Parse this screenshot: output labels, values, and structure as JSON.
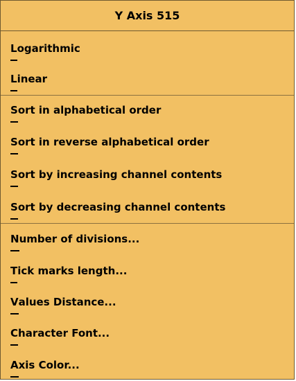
{
  "menu": {
    "title": "Y Axis 515",
    "groups": [
      {
        "items": [
          {
            "label": "Logarithmic",
            "mnemonic": "L",
            "rest": "ogarithmic"
          },
          {
            "label": "Linear",
            "mnemonic": "L",
            "rest": "inear"
          }
        ]
      },
      {
        "items": [
          {
            "label": "Sort in alphabetical order",
            "mnemonic": "S",
            "rest": "ort in alphabetical order"
          },
          {
            "label": "Sort in reverse alphabetical order",
            "mnemonic": "S",
            "rest": "ort in reverse alphabetical order"
          },
          {
            "label": "Sort by increasing channel contents",
            "mnemonic": "S",
            "rest": "ort by increasing channel contents"
          },
          {
            "label": "Sort by decreasing channel contents",
            "mnemonic": "S",
            "rest": "ort by decreasing channel contents"
          }
        ]
      },
      {
        "items": [
          {
            "label": "Number of divisions...",
            "mnemonic": "N",
            "rest": "umber of divisions..."
          },
          {
            "label": "Tick marks length...",
            "mnemonic": "T",
            "rest": "ick marks length..."
          },
          {
            "label": "Values Distance...",
            "mnemonic": "V",
            "rest": "alues Distance..."
          },
          {
            "label": "Character Font...",
            "mnemonic": "C",
            "rest": "haracter Font..."
          },
          {
            "label": "Axis Color...",
            "mnemonic": "A",
            "rest": "xis Color..."
          }
        ]
      }
    ]
  },
  "colors": {
    "menu_background": "#f2c063",
    "border": "#6e5a30",
    "text": "#000000"
  }
}
